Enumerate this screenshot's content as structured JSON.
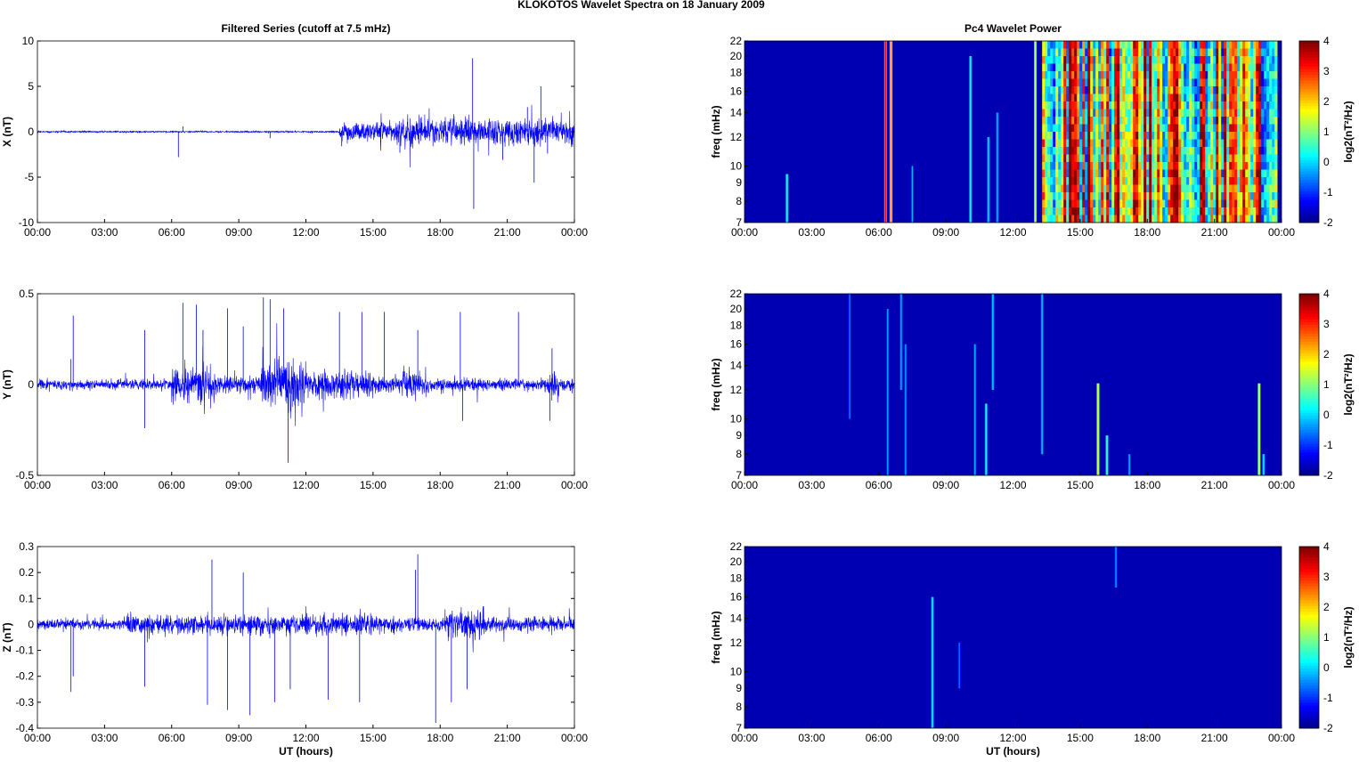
{
  "title": "KLOKOTOS Wavelet Spectra on 18 January   2009",
  "xticks": [
    "00:00",
    "03:00",
    "06:00",
    "09:00",
    "12:00",
    "15:00",
    "18:00",
    "21:00",
    "00:00"
  ],
  "xlabel": "UT (hours)",
  "colors": {
    "trace": "#0000ff",
    "axis": "#000000"
  },
  "chart_data": [
    {
      "type": "line",
      "title": "Filtered Series (cutoff at 7.5 mHz)",
      "ylabel": "X (nT)",
      "xlim": [
        0,
        24
      ],
      "ylim": [
        -10,
        10
      ],
      "yticks": [
        "10",
        "5",
        "0",
        "-5",
        "-10"
      ],
      "ytick_values": [
        10,
        5,
        0,
        -5,
        -10
      ],
      "envelope": [
        [
          0,
          13.5,
          0.08
        ],
        [
          13.5,
          16,
          0.9
        ],
        [
          16,
          24,
          1.3
        ]
      ],
      "spikes": [
        [
          6.3,
          -2.8
        ],
        [
          6.5,
          0.6
        ],
        [
          10.4,
          -0.7
        ],
        [
          13.6,
          -1.6
        ],
        [
          16.2,
          -2.3
        ],
        [
          19.45,
          8.1
        ],
        [
          19.5,
          -8.5
        ],
        [
          20.8,
          -3.1
        ],
        [
          22.2,
          -5.6
        ],
        [
          22.5,
          5.0
        ],
        [
          22.8,
          -2.4
        ],
        [
          21.9,
          2.7
        ]
      ]
    },
    {
      "type": "line",
      "ylabel": "Y (nT)",
      "xlim": [
        0,
        24
      ],
      "ylim": [
        -0.5,
        0.5
      ],
      "yticks": [
        "0.5",
        "0",
        "-0.5"
      ],
      "ytick_values": [
        0.5,
        0,
        -0.5
      ],
      "envelope": [
        [
          0,
          6,
          0.025
        ],
        [
          6,
          8,
          0.09
        ],
        [
          8,
          10,
          0.04
        ],
        [
          10,
          12,
          0.13
        ],
        [
          12,
          15,
          0.07
        ],
        [
          15,
          16.3,
          0.04
        ],
        [
          16.3,
          17.5,
          0.07
        ],
        [
          17.5,
          22.8,
          0.03
        ],
        [
          22.8,
          23.3,
          0.07
        ],
        [
          23.3,
          24,
          0.03
        ]
      ],
      "spikes": [
        [
          1.6,
          0.38
        ],
        [
          1.5,
          0.14
        ],
        [
          4.8,
          0.3
        ],
        [
          4.8,
          -0.24
        ],
        [
          6.5,
          0.45
        ],
        [
          7.1,
          0.44
        ],
        [
          7.4,
          0.3
        ],
        [
          8.5,
          0.42
        ],
        [
          9.2,
          0.32
        ],
        [
          10.1,
          0.48
        ],
        [
          10.4,
          0.47
        ],
        [
          11.2,
          -0.43
        ],
        [
          11.0,
          0.42
        ],
        [
          13.5,
          0.4
        ],
        [
          14.5,
          0.4
        ],
        [
          15.5,
          0.4
        ],
        [
          17.0,
          0.3
        ],
        [
          18.9,
          0.4
        ],
        [
          19.0,
          -0.2
        ],
        [
          21.5,
          0.4
        ],
        [
          23.0,
          0.2
        ],
        [
          22.9,
          -0.2
        ]
      ]
    },
    {
      "type": "line",
      "ylabel": "Z (nT)",
      "xlim": [
        0,
        24
      ],
      "ylim": [
        -0.4,
        0.3
      ],
      "yticks": [
        "0.3",
        "0.2",
        "0.1",
        "0",
        "-0.1",
        "-0.2",
        "-0.3",
        "-0.4"
      ],
      "ytick_values": [
        0.3,
        0.2,
        0.1,
        0,
        -0.1,
        -0.2,
        -0.3,
        -0.4
      ],
      "envelope": [
        [
          0,
          4,
          0.018
        ],
        [
          4,
          16,
          0.035
        ],
        [
          16,
          18.2,
          0.025
        ],
        [
          18.2,
          20,
          0.06
        ],
        [
          20,
          24,
          0.025
        ]
      ],
      "spikes": [
        [
          1.5,
          -0.26
        ],
        [
          1.6,
          -0.2
        ],
        [
          4.8,
          -0.24
        ],
        [
          7.8,
          0.25
        ],
        [
          7.6,
          -0.31
        ],
        [
          8.5,
          -0.33
        ],
        [
          9.2,
          0.2
        ],
        [
          9.5,
          -0.35
        ],
        [
          10.6,
          -0.3
        ],
        [
          11.3,
          -0.25
        ],
        [
          13.0,
          -0.29
        ],
        [
          14.4,
          -0.3
        ],
        [
          16.9,
          0.21
        ],
        [
          17.0,
          0.27
        ],
        [
          17.8,
          -0.38
        ],
        [
          18.5,
          -0.3
        ],
        [
          19.2,
          -0.25
        ]
      ]
    },
    {
      "type": "heatmap",
      "title": "Pc4 Wavelet Power",
      "ylabel": "freq (mHz)",
      "xlim": [
        0,
        24
      ],
      "ylim": [
        7,
        22
      ],
      "yticks": [
        "22",
        "20",
        "18",
        "16",
        "14",
        "12",
        "10",
        "9",
        "8",
        "7"
      ],
      "ytick_values": [
        22,
        20,
        18,
        16,
        14,
        12,
        10,
        9,
        8,
        7
      ],
      "clim": [
        -2,
        4
      ],
      "cticks": [
        "4",
        "3",
        "2",
        "1",
        "0",
        "-1",
        "-2"
      ],
      "cbar_label": "log2(nT²/Hz)",
      "baseline": -1.7,
      "broadband": [
        13.3,
        23.7,
        -1,
        4
      ],
      "bursts": [
        [
          1.9,
          7,
          9.5,
          -0.2
        ],
        [
          6.3,
          7,
          22,
          2.5
        ],
        [
          6.55,
          7,
          22,
          1.8
        ],
        [
          7.5,
          7,
          10,
          -1
        ],
        [
          10.1,
          7,
          20,
          -0.3
        ],
        [
          10.9,
          7,
          12,
          -0.6
        ],
        [
          11.3,
          7,
          14,
          -0.8
        ],
        [
          13.0,
          7,
          22,
          0.5
        ]
      ]
    },
    {
      "type": "heatmap",
      "ylabel": "freq (mHz)",
      "xlim": [
        0,
        24
      ],
      "ylim": [
        7,
        22
      ],
      "yticks": [
        "22",
        "20",
        "18",
        "16",
        "14",
        "12",
        "10",
        "9",
        "8",
        "7"
      ],
      "ytick_values": [
        22,
        20,
        18,
        16,
        14,
        12,
        10,
        9,
        8,
        7
      ],
      "clim": [
        -2,
        4
      ],
      "cticks": [
        "4",
        "3",
        "2",
        "1",
        "0",
        "-1",
        "-2"
      ],
      "cbar_label": "log2(nT²/Hz)",
      "baseline": -1.7,
      "bursts": [
        [
          4.7,
          10,
          22,
          -1.2
        ],
        [
          6.4,
          7,
          20,
          -1
        ],
        [
          7.0,
          12,
          22,
          -0.9
        ],
        [
          7.2,
          7,
          16,
          -1
        ],
        [
          10.3,
          7,
          16,
          -0.9
        ],
        [
          10.8,
          7,
          11,
          -0.3
        ],
        [
          11.1,
          12,
          22,
          -0.7
        ],
        [
          13.3,
          8,
          22,
          -0.8
        ],
        [
          15.8,
          7,
          12.5,
          0.9
        ],
        [
          16.2,
          7,
          9,
          0
        ],
        [
          17.2,
          7,
          8,
          -0.9
        ],
        [
          23.0,
          7,
          12.5,
          0.9
        ],
        [
          23.2,
          7,
          8,
          -0.5
        ]
      ]
    },
    {
      "type": "heatmap",
      "ylabel": "freq (mHz)",
      "xlim": [
        0,
        24
      ],
      "ylim": [
        7,
        22
      ],
      "yticks": [
        "22",
        "20",
        "18",
        "16",
        "14",
        "12",
        "10",
        "9",
        "8",
        "7"
      ],
      "ytick_values": [
        22,
        20,
        18,
        16,
        14,
        12,
        10,
        9,
        8,
        7
      ],
      "clim": [
        -2,
        4
      ],
      "cticks": [
        "4",
        "3",
        "2",
        "1",
        "0",
        "-1",
        "-2"
      ],
      "cbar_label": "log2(nT²/Hz)",
      "baseline": -1.7,
      "bursts": [
        [
          8.4,
          7,
          16,
          -0.4
        ],
        [
          9.6,
          9,
          12,
          -1.2
        ],
        [
          16.6,
          17,
          22,
          -1
        ]
      ]
    }
  ]
}
